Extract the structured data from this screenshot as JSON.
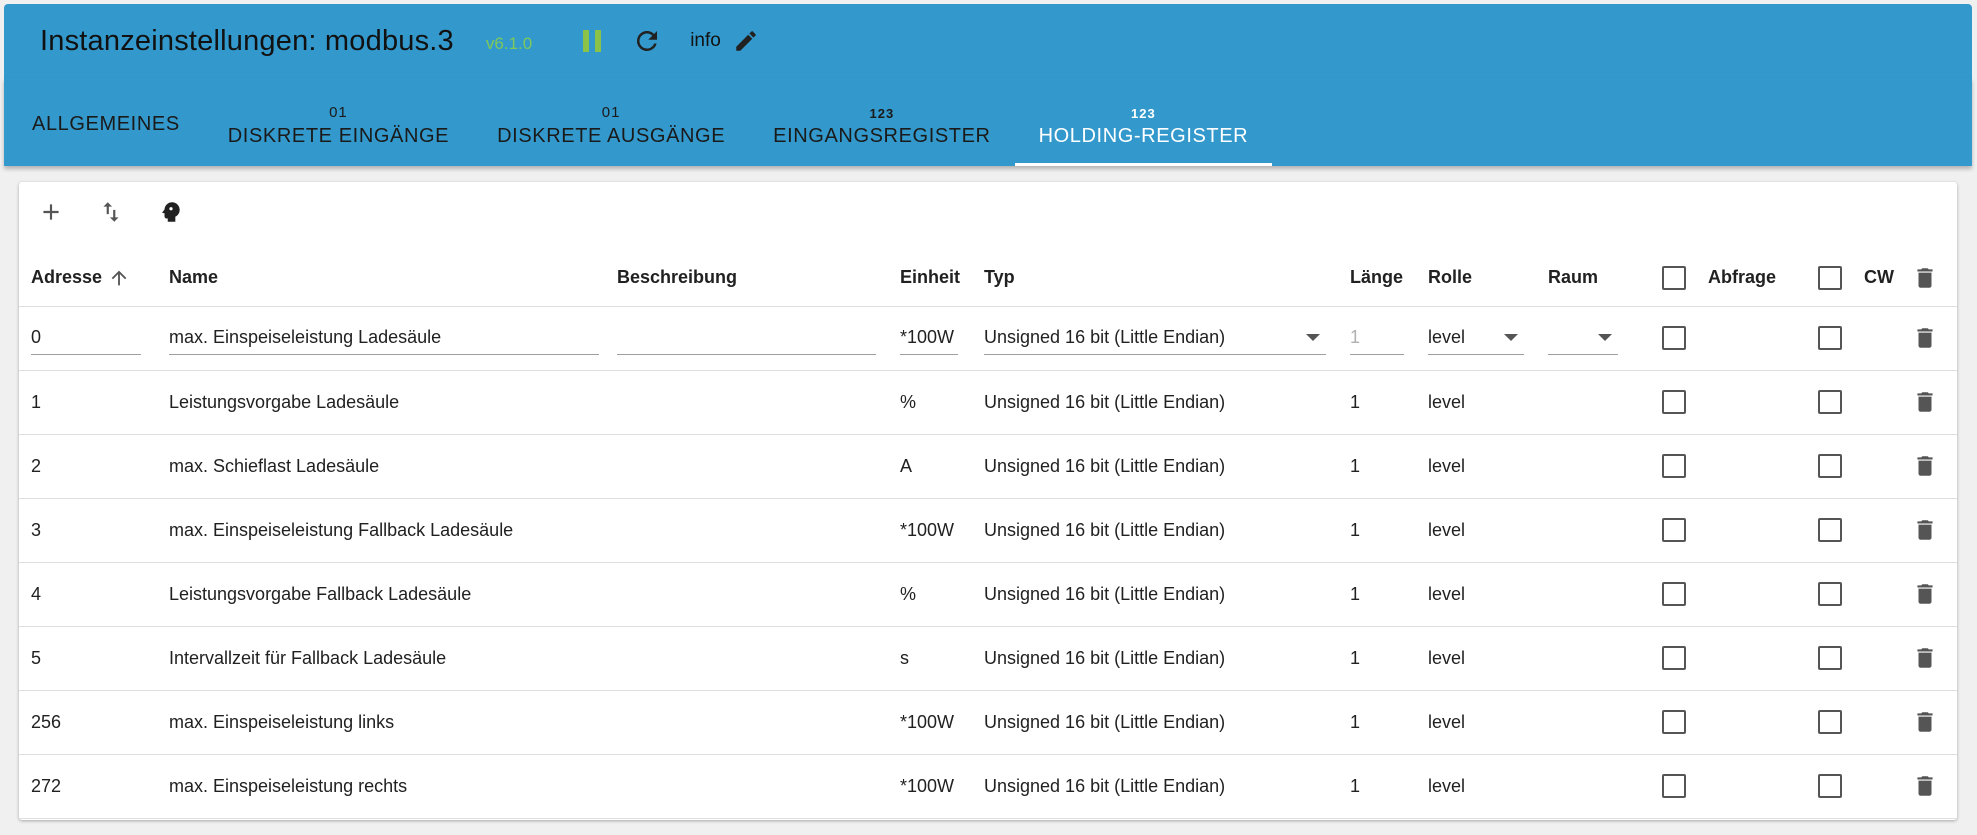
{
  "header": {
    "title": "Instanzeinstellungen: modbus.3",
    "version": "v6.1.0",
    "info_label": "info",
    "icons": [
      "pause-icon",
      "refresh-icon",
      "edit-icon"
    ]
  },
  "tabs": [
    {
      "label": "ALLGEMEINES",
      "sub": ""
    },
    {
      "label": "DISKRETE EINGÄNGE",
      "sub": "01"
    },
    {
      "label": "DISKRETE AUSGÄNGE",
      "sub": "01"
    },
    {
      "label": "EINGANGSREGISTER",
      "sub": "123"
    },
    {
      "label": "HOLDING-REGISTER",
      "sub": "123"
    }
  ],
  "active_tab": "HOLDING-REGISTER",
  "toolbar": {
    "icons": [
      "add-icon",
      "import-export-icon",
      "head-icon"
    ]
  },
  "table": {
    "columns": {
      "address": "Adresse",
      "name": "Name",
      "description": "Beschreibung",
      "unit": "Einheit",
      "type": "Typ",
      "length": "Länge",
      "role": "Rolle",
      "room": "Raum",
      "poll": "Abfrage",
      "cw": "CW"
    },
    "edit_row": {
      "address": "0",
      "name": "max. Einspeiseleistung Ladesäule",
      "description": "",
      "unit": "*100W",
      "type": "Unsigned 16 bit (Little Endian)",
      "length": "1",
      "role": "level",
      "room": ""
    },
    "rows": [
      {
        "address": "1",
        "name": "Leistungsvorgabe Ladesäule",
        "unit": "%",
        "type": "Unsigned 16 bit (Little Endian)",
        "length": "1",
        "role": "level"
      },
      {
        "address": "2",
        "name": "max. Schieflast Ladesäule",
        "unit": "A",
        "type": "Unsigned 16 bit (Little Endian)",
        "length": "1",
        "role": "level"
      },
      {
        "address": "3",
        "name": "max. Einspeiseleistung Fallback Ladesäule",
        "unit": "*100W",
        "type": "Unsigned 16 bit (Little Endian)",
        "length": "1",
        "role": "level"
      },
      {
        "address": "4",
        "name": "Leistungsvorgabe Fallback Ladesäule",
        "unit": "%",
        "type": "Unsigned 16 bit (Little Endian)",
        "length": "1",
        "role": "level"
      },
      {
        "address": "5",
        "name": "Intervallzeit für Fallback Ladesäule",
        "unit": "s",
        "type": "Unsigned 16 bit (Little Endian)",
        "length": "1",
        "role": "level"
      },
      {
        "address": "256",
        "name": "max. Einspeiseleistung links",
        "unit": "*100W",
        "type": "Unsigned 16 bit (Little Endian)",
        "length": "1",
        "role": "level"
      },
      {
        "address": "272",
        "name": "max. Einspeiseleistung rechts",
        "unit": "*100W",
        "type": "Unsigned 16 bit (Little Endian)",
        "length": "1",
        "role": "level"
      }
    ]
  },
  "colors": {
    "header_bg": "#3399cc",
    "version_text": "#7ec85a",
    "pause_icon": "#8bc34a",
    "active_tab_text": "#ffffff"
  }
}
